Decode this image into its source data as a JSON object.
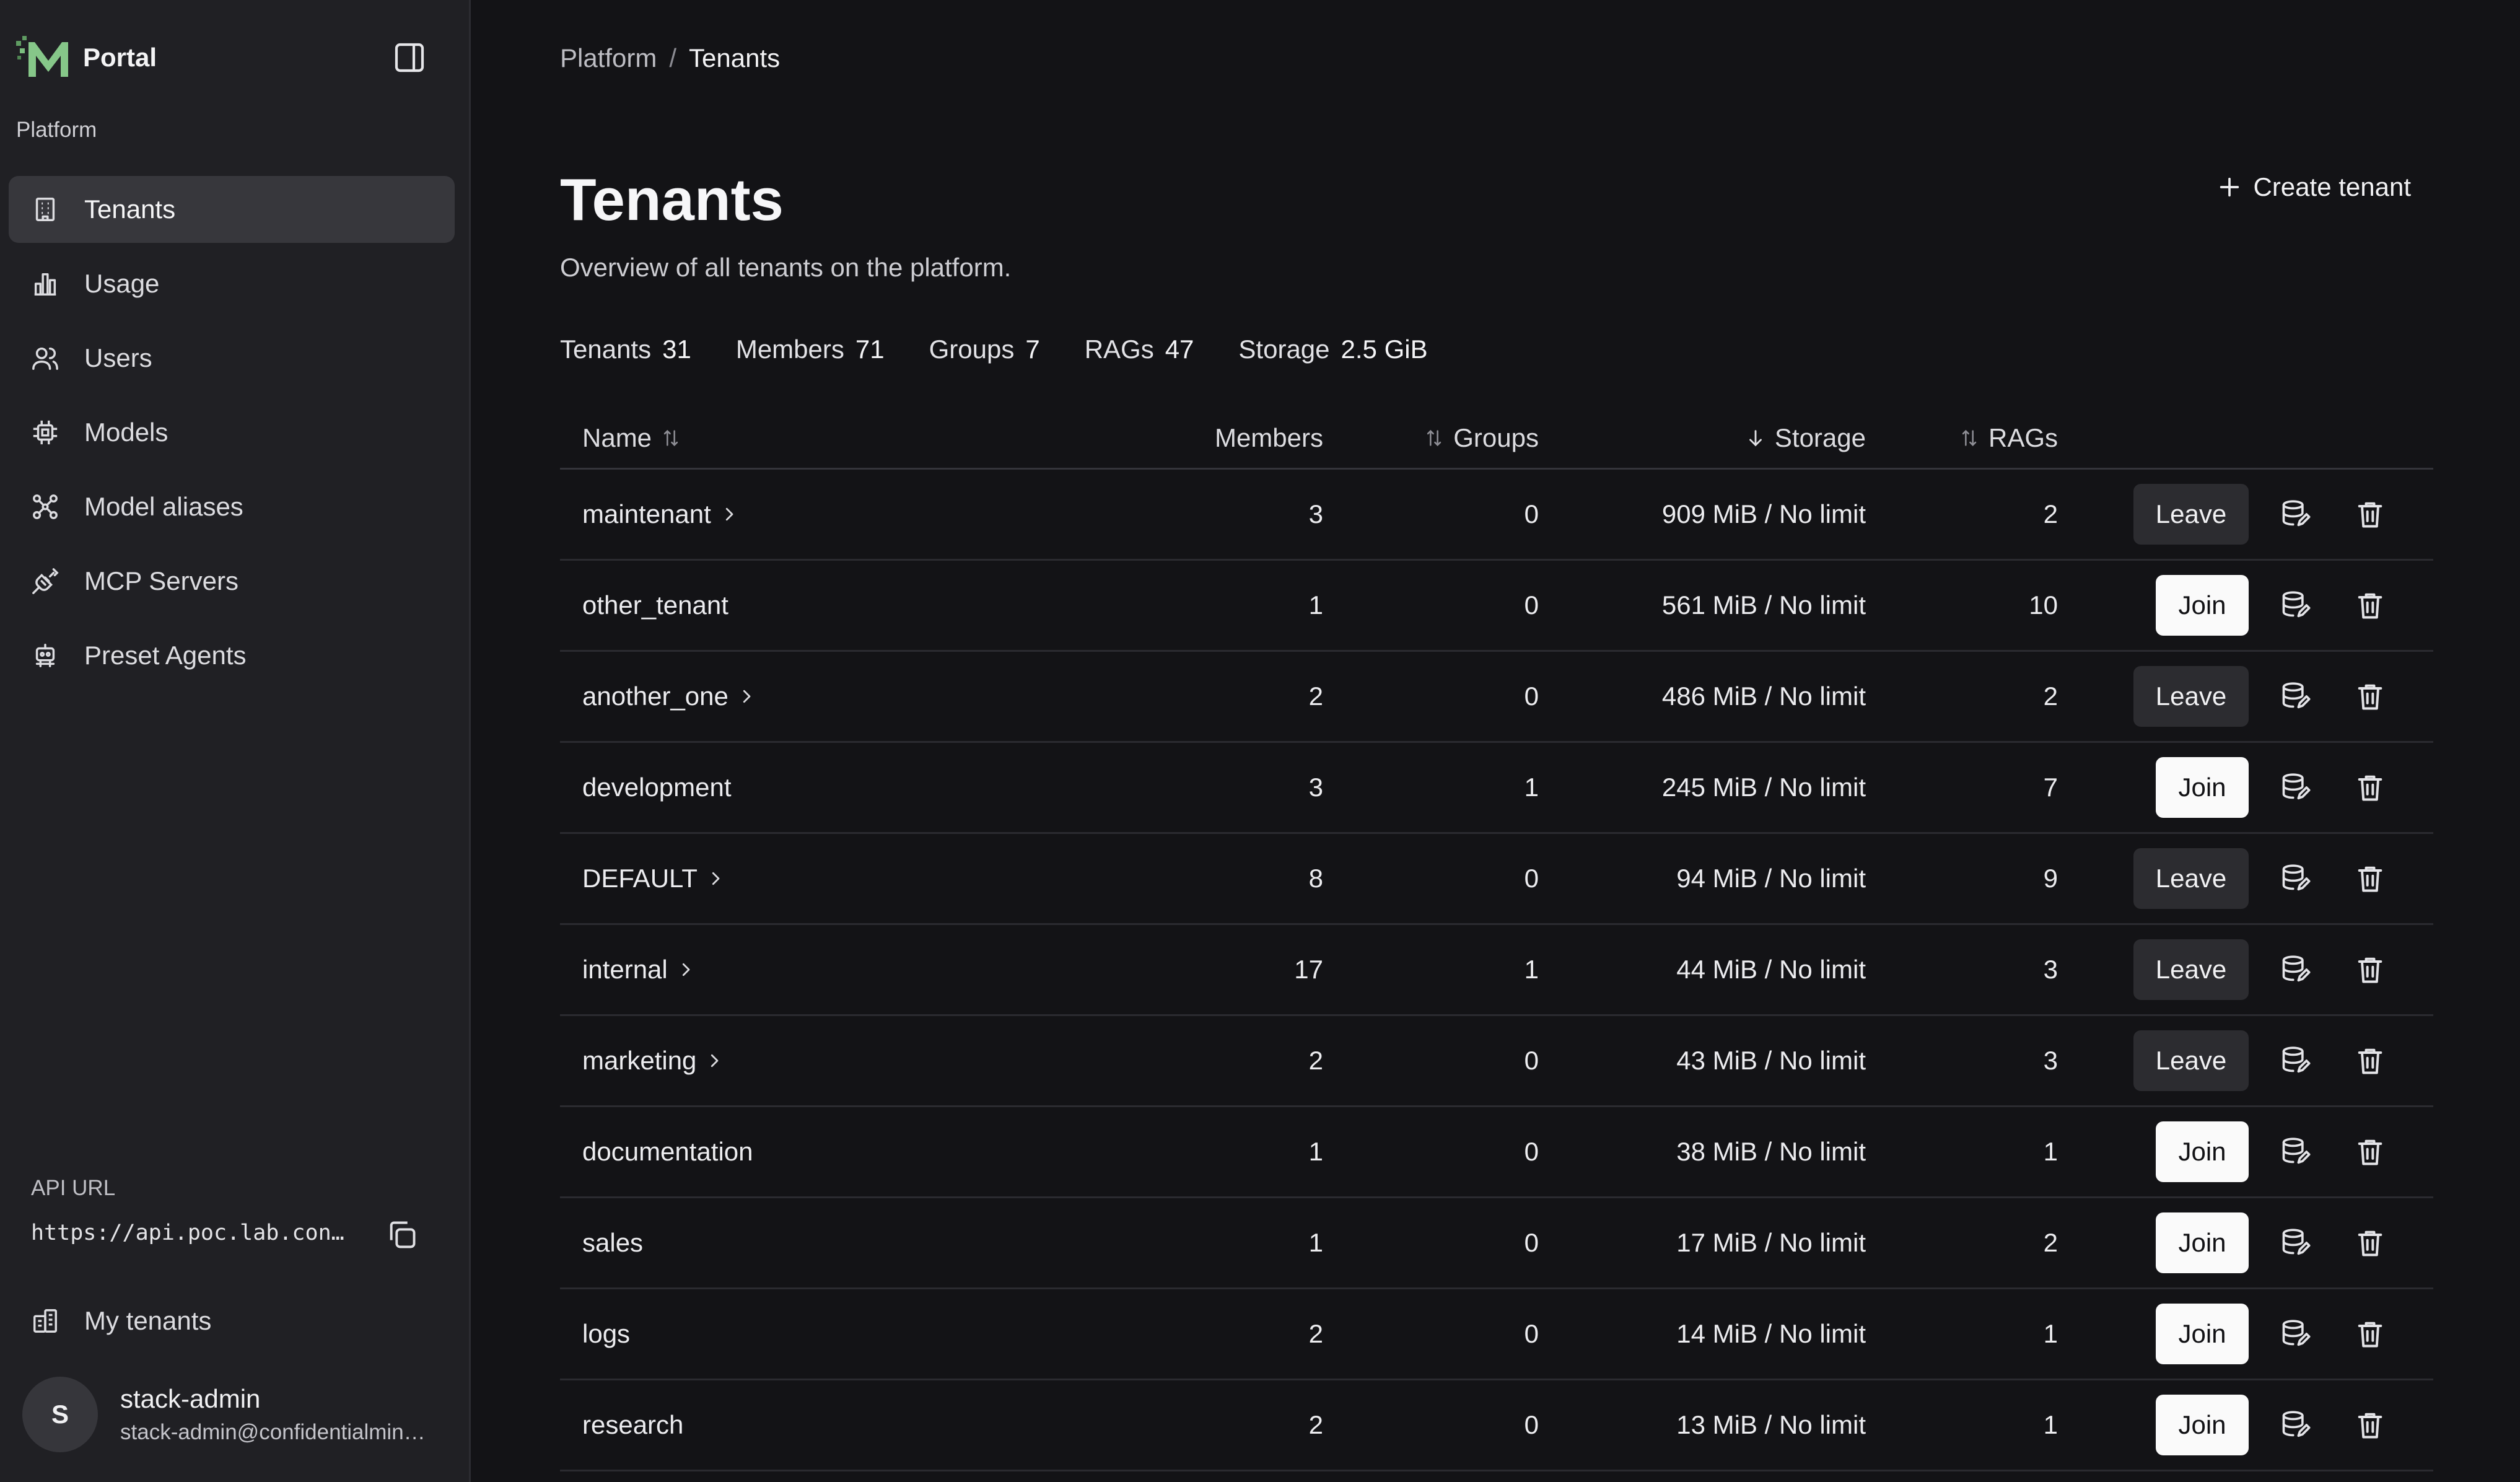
{
  "app": {
    "name": "Portal"
  },
  "sidebar": {
    "section_label": "Platform",
    "items": [
      {
        "label": "Tenants",
        "icon": "building-icon",
        "active": true
      },
      {
        "label": "Usage",
        "icon": "bar-chart-icon",
        "active": false
      },
      {
        "label": "Users",
        "icon": "users-icon",
        "active": false
      },
      {
        "label": "Models",
        "icon": "chip-icon",
        "active": false
      },
      {
        "label": "Model aliases",
        "icon": "network-icon",
        "active": false
      },
      {
        "label": "MCP Servers",
        "icon": "plug-icon",
        "active": false
      },
      {
        "label": "Preset Agents",
        "icon": "robot-icon",
        "active": false
      }
    ],
    "api_label": "API URL",
    "api_url": "https://api.poc.lab.con…",
    "my_tenants": "My tenants",
    "user": {
      "initial": "S",
      "name": "stack-admin",
      "email": "stack-admin@confidentialmin…"
    }
  },
  "breadcrumb": {
    "parent": "Platform",
    "separator": "/",
    "current": "Tenants"
  },
  "page": {
    "title": "Tenants",
    "subtitle": "Overview of all tenants on the platform.",
    "create_label": "Create tenant"
  },
  "stats": [
    {
      "label": "Tenants",
      "value": "31"
    },
    {
      "label": "Members",
      "value": "71"
    },
    {
      "label": "Groups",
      "value": "7"
    },
    {
      "label": "RAGs",
      "value": "47"
    },
    {
      "label": "Storage",
      "value": "2.5 GiB"
    }
  ],
  "table": {
    "columns": {
      "name": "Name",
      "members": "Members",
      "groups": "Groups",
      "storage": "Storage",
      "rags": "RAGs"
    },
    "rows": [
      {
        "name": "maintenant",
        "members": "3",
        "groups": "0",
        "storage": "909 MiB / No limit",
        "rags": "2",
        "action": "Leave",
        "expandable": true
      },
      {
        "name": "other_tenant",
        "members": "1",
        "groups": "0",
        "storage": "561 MiB / No limit",
        "rags": "10",
        "action": "Join",
        "expandable": false
      },
      {
        "name": "another_one",
        "members": "2",
        "groups": "0",
        "storage": "486 MiB / No limit",
        "rags": "2",
        "action": "Leave",
        "expandable": true
      },
      {
        "name": "development",
        "members": "3",
        "groups": "1",
        "storage": "245 MiB / No limit",
        "rags": "7",
        "action": "Join",
        "expandable": false
      },
      {
        "name": "DEFAULT",
        "members": "8",
        "groups": "0",
        "storage": "94 MiB / No limit",
        "rags": "9",
        "action": "Leave",
        "expandable": true
      },
      {
        "name": "internal",
        "members": "17",
        "groups": "1",
        "storage": "44 MiB / No limit",
        "rags": "3",
        "action": "Leave",
        "expandable": true
      },
      {
        "name": "marketing",
        "members": "2",
        "groups": "0",
        "storage": "43 MiB / No limit",
        "rags": "3",
        "action": "Leave",
        "expandable": true
      },
      {
        "name": "documentation",
        "members": "1",
        "groups": "0",
        "storage": "38 MiB / No limit",
        "rags": "1",
        "action": "Join",
        "expandable": false
      },
      {
        "name": "sales",
        "members": "1",
        "groups": "0",
        "storage": "17 MiB / No limit",
        "rags": "2",
        "action": "Join",
        "expandable": false
      },
      {
        "name": "logs",
        "members": "2",
        "groups": "0",
        "storage": "14 MiB / No limit",
        "rags": "1",
        "action": "Join",
        "expandable": false
      },
      {
        "name": "research",
        "members": "2",
        "groups": "0",
        "storage": "13 MiB / No limit",
        "rags": "1",
        "action": "Join",
        "expandable": false
      }
    ]
  },
  "colors": {
    "background": "#131316",
    "sidebar": "#202024",
    "active_nav": "#37373c",
    "logo_green": "#7bbd7e"
  }
}
